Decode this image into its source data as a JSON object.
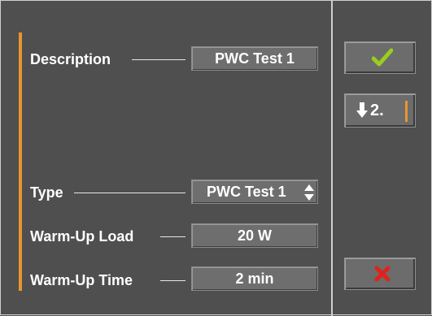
{
  "form": {
    "description": {
      "label": "Description",
      "value": "PWC Test 1"
    },
    "type": {
      "label": "Type",
      "value": "PWC Test 1"
    },
    "warmup_load": {
      "label": "Warm-Up Load",
      "value": "20 W"
    },
    "warmup_time": {
      "label": "Warm-Up Time",
      "value": "2 min"
    }
  },
  "sidebar": {
    "confirm": {
      "icon": "checkmark-icon",
      "color": "#9acd1e"
    },
    "next": {
      "icon": "arrow-down-icon",
      "label": "2."
    },
    "cancel": {
      "icon": "x-icon",
      "color": "#e0221b"
    }
  },
  "colors": {
    "accent": "#e8962e",
    "background": "#4f4f4f"
  }
}
